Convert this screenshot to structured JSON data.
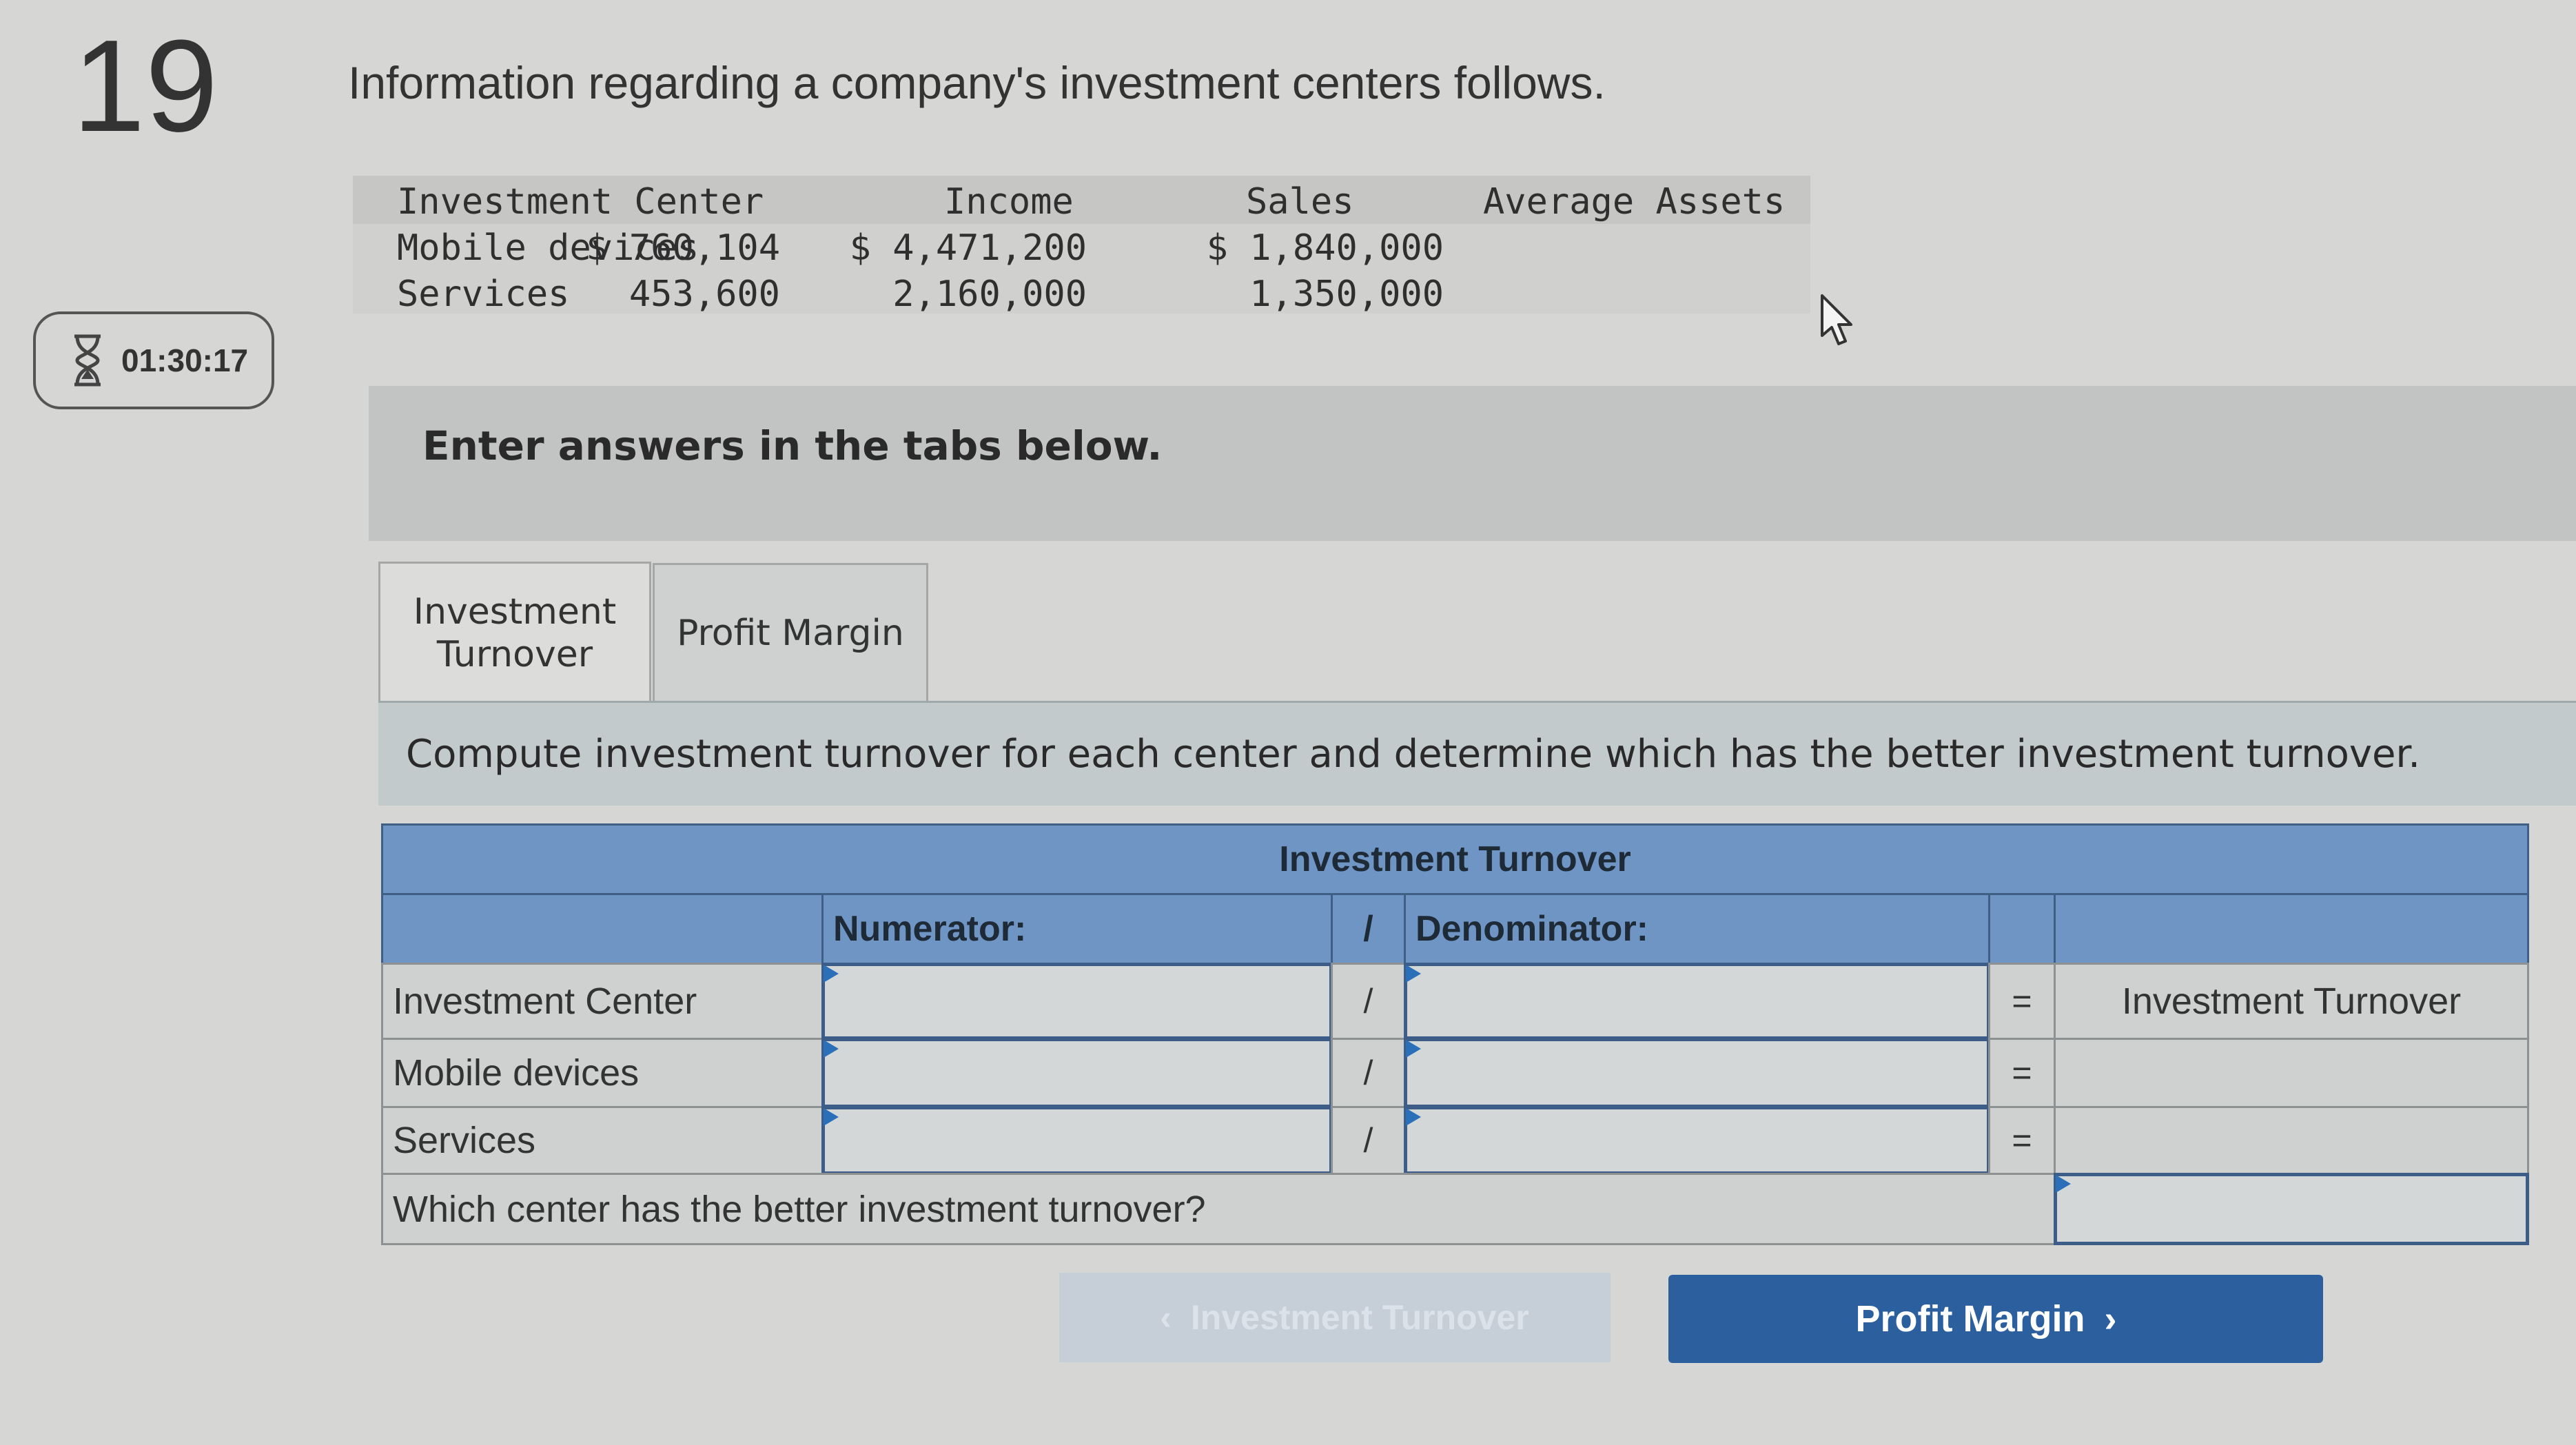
{
  "question": {
    "number": "19",
    "timer": "01:30:17",
    "intro": "Information regarding a company's investment centers follows."
  },
  "given_table": {
    "headers": [
      "Investment Center",
      "Income",
      "Sales",
      "Average Assets"
    ],
    "rows": [
      [
        "Mobile devices",
        "$ 760,104",
        "$ 4,471,200",
        "$ 1,840,000"
      ],
      [
        "Services",
        "453,600",
        "2,160,000",
        "1,350,000"
      ]
    ]
  },
  "answer_box": {
    "title": "Enter answers in the tabs below."
  },
  "tabs": [
    {
      "label": "Investment Turnover",
      "active": true
    },
    {
      "label": "Profit Margin",
      "active": false
    }
  ],
  "instruction": "Compute investment turnover for each center and determine which has the better investment turnover.",
  "grid": {
    "title": "Investment Turnover",
    "numerator_label": "Numerator:",
    "slash": "/",
    "denominator_label": "Denominator:",
    "equals": "=",
    "header_row": {
      "label": "Investment Center",
      "result": "Investment Turnover"
    },
    "rows": [
      {
        "label": "Mobile devices"
      },
      {
        "label": "Services"
      }
    ],
    "question": "Which center has the better investment turnover?"
  },
  "nav": {
    "prev_label": "Investment Turnover",
    "next_label": "Profit Margin"
  },
  "colors": {
    "header_blue": "#6f95c5",
    "button_blue": "#2c5f9e",
    "input_border": "#3b5d88"
  }
}
